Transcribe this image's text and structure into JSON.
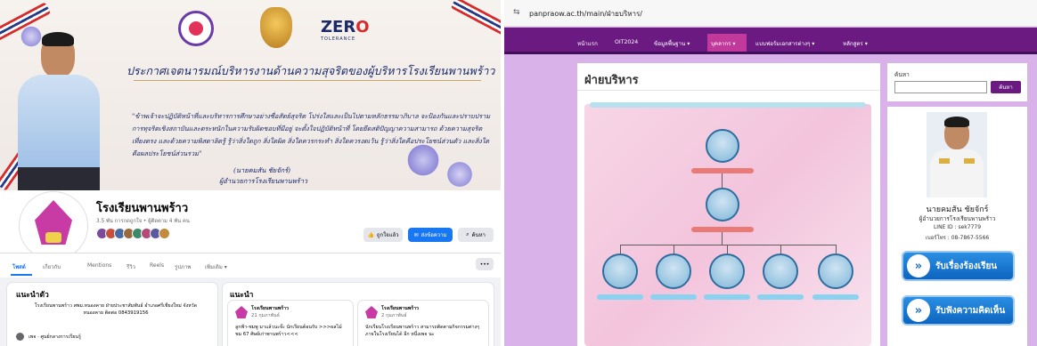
{
  "facebook": {
    "cover": {
      "headline": "ประกาศเจตนารมณ์บริหารงานด้านความสุจริตของผู้บริหารโรงเรียนพานพร้าว",
      "quote": "\"ข้าพเจ้าจะปฏิบัติหน้าที่และบริหารการศึกษาอย่างซื่อสัตย์สุจริต โปร่งใสและเป็นไปตามหลักธรรมาภิบาล จะป้องกันและปราบปรามการทุจริตเชิงสถาบันและตระหนักในความรับผิดชอบที่มีอยู่ จะตั้งใจปฏิบัติหน้าที่ โดยยึดสติปัญญาความสามารถ ด้วยความสุจริต เที่ยงตรง และด้วยความพิสดาลิตรู้ รู้ว่าสิ่งใดถูก สิ่งใดผิด สิ่งใดควรกระทำ สิ่งใดควรงดเว้น รู้ว่าสิ่งใดคือประโยชน์ส่วนตัว และสิ่งใดคือผลประโยชน์ส่วนรวม\"",
      "signature": "(นายคมสัน ชัยจักร์)",
      "signature_role": "ผู้อำนวยการโรงเรียนพานพร้าว",
      "zero_logo": "ZER",
      "zero_logo_o": "O",
      "zero_logo_sub": "TOLERANCE"
    },
    "page_name": "โรงเรียนพานพร้าว",
    "page_stats": "3.5 พัน การกดถูกใจ • ผู้ติดตาม 4 พัน คน",
    "btn_liked": "ถูกใจแล้ว",
    "btn_message": "ส่งข้อความ",
    "btn_search": "ค้นหา",
    "tabs": [
      "โพสต์",
      "เกี่ยวกับ",
      "Mentions",
      "รีวิว",
      "Reels",
      "รูปภาพ",
      "เพิ่มเติม ▾"
    ],
    "more_btn": "•••",
    "intro": {
      "title": "แนะนำตัว",
      "text": "โรงเรียนพานพร้าว สพม.หนองคาย ฝ่ายประชาสัมพันธ์ อำเภอศรีเชียงใหม่ จังหวัดหนองคาย ติดต่อ 0843919156",
      "item": "เพจ · ศูนย์กลางการเรียนรู้"
    },
    "featured": {
      "title": "แนะนำ",
      "posts": [
        {
          "author": "โรงเรียนพานพร้าว",
          "date": "21 กุมภาพันธ์",
          "text": "ลูกฟ้า-ชมพู มาแล้วนะจ๊ะ นักเรียนต้อนรับ >>>ผลไม้ชม 67 ศิษย์เก่าพานพร้าว<<<"
        },
        {
          "author": "โรงเรียนพานพร้าว",
          "date": "2 กุมภาพันธ์",
          "text": "นักเรียนโรงเรียนพานพร้าว สามารถติดตามกิจกรรมต่างๆภายในโรงเรียนได้ อีก หนึ่งเพจ นะ"
        }
      ]
    }
  },
  "website": {
    "url": "panpraow.ac.th/main/ฝ่ายบริหาร/",
    "nav": [
      "หน้าแรก",
      "OIT2024",
      "ข้อมูลพื้นฐาน ▾",
      "บุคลากร ▾",
      "แบบฟอร์มเอกสารต่างๆ ▾",
      "หลักสูตร ▾"
    ],
    "page_title": "ฝ่ายบริหาร",
    "search_label": "ค้นหา",
    "search_placeholder": "",
    "search_button": "ค้นหา",
    "director_name": "นายคมสัน ชัยจักร์",
    "director_role": "ผู้อำนวยการโรงเรียนพานพร้าว",
    "line_id": "LINE ID : sek7779",
    "phone": "เบอร์โทร : 08-7867-5566",
    "btn_complaint": "รับเรื่องร้องเรียน",
    "btn_feedback": "รับฟังความคิดเห็น"
  },
  "colors": {
    "fb_blue": "#1877f2",
    "site_purple": "#6a1a80",
    "site_bg": "#d9b2ea"
  }
}
